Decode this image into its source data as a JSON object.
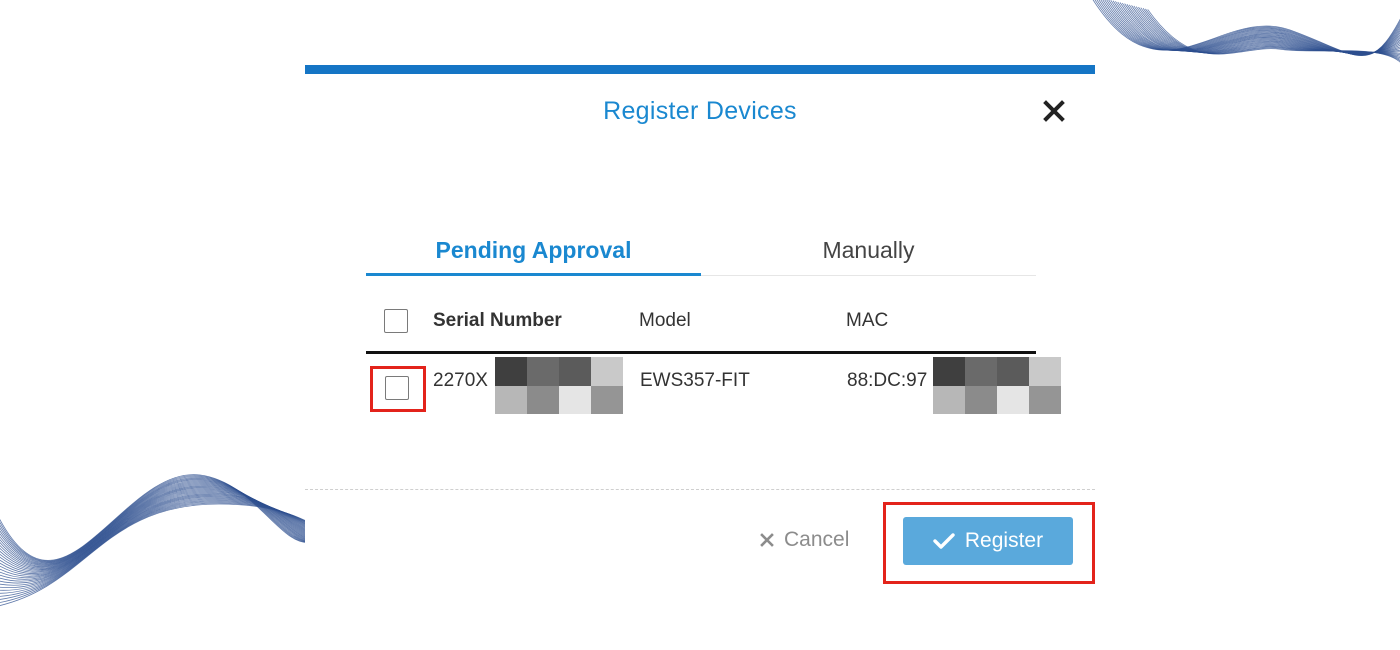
{
  "dialog": {
    "title": "Register Devices",
    "accent_color": "#1575c5",
    "close_icon": "close-icon"
  },
  "tabs": [
    {
      "label": "Pending Approval",
      "active": true
    },
    {
      "label": "Manually",
      "active": false
    }
  ],
  "table": {
    "columns": [
      "Serial Number",
      "Model",
      "MAC"
    ],
    "rows": [
      {
        "checked": false,
        "serial": "2270X",
        "model": "EWS357-FIT",
        "mac": "88:DC:97"
      }
    ]
  },
  "actions": {
    "cancel_label": "Cancel",
    "cancel_icon": "close-icon",
    "register_label": "Register",
    "register_icon": "check-icon",
    "register_color": "#5aa9dc"
  },
  "highlight_color": "#e3231b"
}
